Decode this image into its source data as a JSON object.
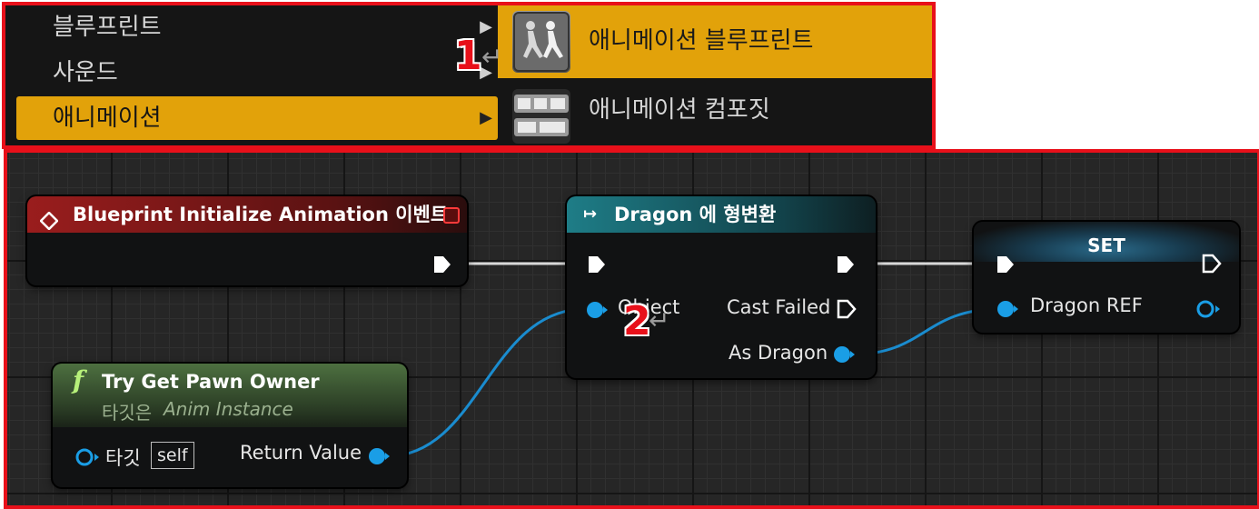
{
  "menu": {
    "categories": [
      {
        "label": "블루프린트",
        "arrow": "▶"
      },
      {
        "label": "사운드",
        "arrow": "▶"
      },
      {
        "label": "애니메이션",
        "arrow": "▶"
      }
    ],
    "submenu": [
      {
        "label": "애니메이션 블루프린트",
        "icon": "animation-blueprint-icon"
      },
      {
        "label": "애니메이션 컴포짓",
        "icon": "animation-composite-icon"
      }
    ],
    "callout_1": "1",
    "enter_symbol": "↵"
  },
  "graph": {
    "callout_2": "2",
    "enter_symbol": "↵",
    "event_node": {
      "title": "Blueprint Initialize Animation 이벤트",
      "color": "#8e1b1b"
    },
    "cast_node": {
      "title": "Dragon 에 형변환",
      "object_pin": "Object",
      "cast_failed_pin": "Cast Failed",
      "as_dragon_pin": "As Dragon",
      "color": "#1d6f78"
    },
    "set_node": {
      "title": "SET",
      "dragon_ref_pin": "Dragon REF"
    },
    "func_node": {
      "title": "Try Get Pawn Owner",
      "subtitle_prefix": "타깃은",
      "subtitle_class": "Anim Instance",
      "target_pin": "타깃",
      "self_label": "self",
      "return_pin": "Return Value",
      "color": "#4a6b3c"
    },
    "colors": {
      "object_pin": "#1a9ee6",
      "exec_wire": "#d9d9d9",
      "accent": "#e2a20a",
      "callout": "#e8101a"
    }
  }
}
